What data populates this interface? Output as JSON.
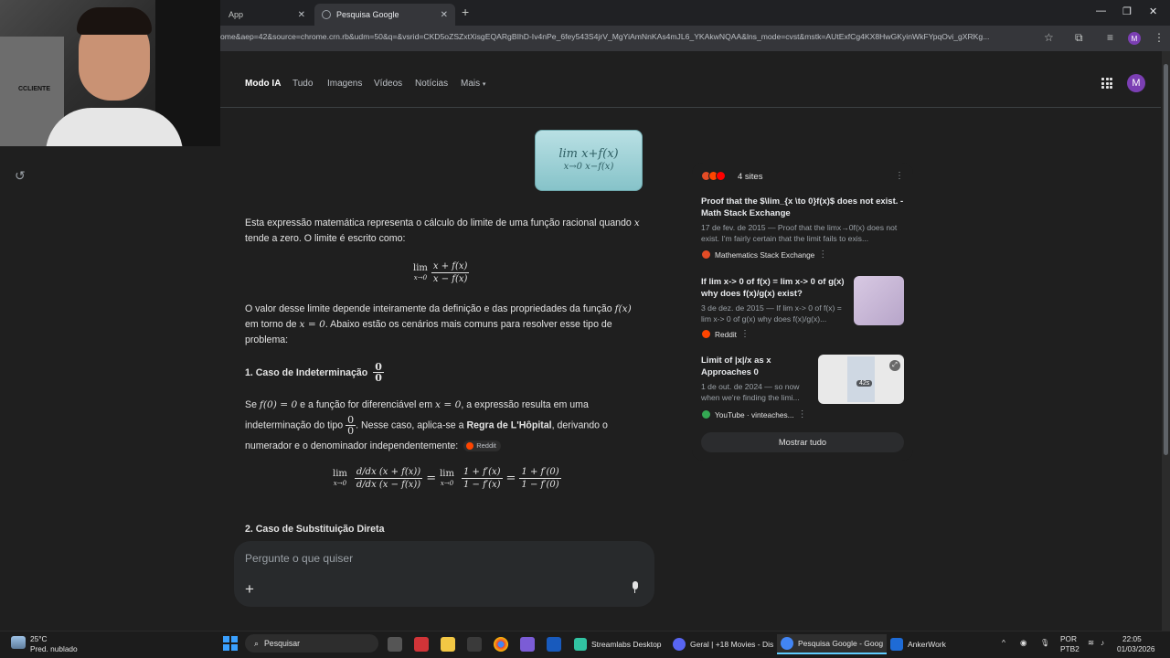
{
  "browser": {
    "tabs": [
      {
        "label": "App",
        "active": false
      },
      {
        "label": "Pesquisa Google",
        "active": true
      }
    ],
    "url": "ome&aep=42&source=chrome.crn.rb&udm=50&q=&vsrid=CKD5oZSZxtXisgEQARgBIhD-Iv4nPe_6fey543S4jrV_MgYiAmNnKAs4mJL6_YKAkwNQAA&lns_mode=cvst&mstk=AUtExfCg4KX8HwGKyinWkFYpqOvi_gXRKg...",
    "profile_initial": "M"
  },
  "nav": {
    "items": [
      "Modo IA",
      "Tudo",
      "Imagens",
      "Vídeos",
      "Notícias",
      "Mais"
    ],
    "active_index": 0,
    "avatar_initial": "M"
  },
  "webcam": {
    "shelf_text": "CCLIENTE"
  },
  "query_image": {
    "line1": "lim x+f(x)",
    "line2": "x→0  x−f(x)"
  },
  "answer": {
    "intro_pre": "Esta expressão matemática representa o cálculo do limite de uma função racional quando",
    "intro_var": "x",
    "intro_post": "tende a zero. O limite é escrito como:",
    "formula1": {
      "lim": "lim",
      "sub": "x→0",
      "num": "x + f(x)",
      "den": "x − f(x)"
    },
    "para2_pre": "O valor desse limite depende inteiramente da definição e das propriedades da função",
    "para2_fx": "f(x)",
    "para2_mid": "em torno de",
    "para2_x0": "x = 0",
    "para2_post": ". Abaixo estão os cenários mais comuns para resolver esse tipo de problema:",
    "section1_title": "1. Caso de Indeterminação",
    "section1_frac": {
      "num": "0",
      "den": "0"
    },
    "s1_a": "Se",
    "s1_f0": "f(0) = 0",
    "s1_b": "e a função for diferenciável em",
    "s1_x0": "x = 0",
    "s1_c": ", a expressão resulta em uma indeterminação do tipo",
    "s1_frac": {
      "num": "0",
      "den": "0"
    },
    "s1_d": ". Nesse caso, aplica-se a",
    "s1_bold": "Regra de L'Hôpital",
    "s1_e": ", derivando o numerador e o denominador independentemente:",
    "s1_chip": "Reddit",
    "formula2": {
      "lim": "lim",
      "sub": "x→0",
      "num1": "d/dx (x + f(x))",
      "den1": "d/dx (x − f(x))",
      "eq": "=",
      "num2": "1 + f′(x)",
      "den2": "1 − f′(x)",
      "num3": "1 + f′(0)",
      "den3": "1 − f′(0)"
    },
    "section2_title": "2. Caso de Substituição Direta"
  },
  "prompt": {
    "placeholder": "Pergunte o que quiser",
    "plus": "+"
  },
  "sources": {
    "count_label": "4 sites",
    "items": [
      {
        "title": "Proof that the $\\lim_{x \\to 0}f(x)$ does not exist. - Math Stack Exchange",
        "snippet": "17 de fev. de 2015 — Proof that the limx→0f(x) does not exist. I'm fairly certain that the limit fails to exis...",
        "site": "Mathematics Stack Exchange",
        "fav_color": "#e34c26"
      },
      {
        "title": "If lim x-> 0 of f(x) = lim x-> 0 of g(x) why does f(x)/g(x) exist?",
        "snippet": "3 de dez. de 2015 — If lim x-> 0 of f(x) = lim x-> 0 of g(x) why does f(x)/g(x)...",
        "site": "Reddit",
        "fav_color": "#ff4500"
      },
      {
        "title": "Limit of |x|/x as x Approaches 0",
        "snippet": "1 de out. de 2024 — so now when we're finding the limi...",
        "site": "YouTube · vinteaches...",
        "fav_color": "#34a853",
        "duration": "42s"
      }
    ],
    "show_all": "Mostrar tudo"
  },
  "taskbar": {
    "weather_temp": "25°C",
    "weather_desc": "Pred. nublado",
    "search": "Pesquisar",
    "apps": [
      {
        "label": "Streamlabs Desktop",
        "color": "#31c3a2"
      },
      {
        "label": "Geral | +18 Movies - Dis",
        "color": "#5865f2"
      },
      {
        "label": "Pesquisa Google - Goog",
        "color": "#4285f4"
      },
      {
        "label": "AnkerWork",
        "color": "#1e6bd6"
      }
    ],
    "lang1": "POR",
    "lang2": "PTB2",
    "time": "22:05",
    "date": "01/03/2026"
  },
  "colors": {
    "accent": "#7b3fb3",
    "background": "#1f1f1f",
    "text": "#e3e3e3"
  }
}
